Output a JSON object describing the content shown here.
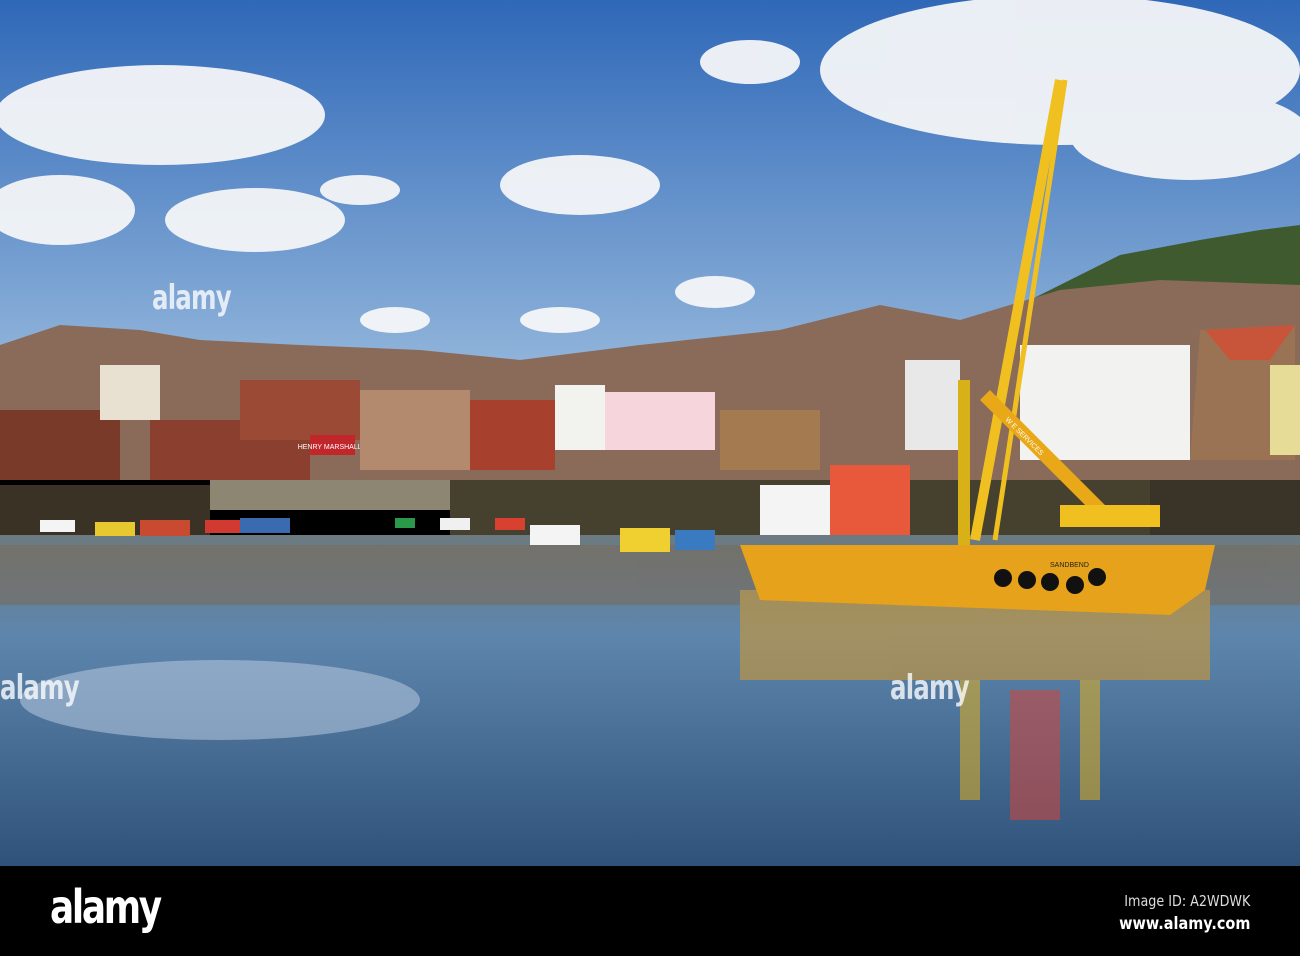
{
  "photo": {
    "signs": {
      "shop": "HENRY MARSHALLS",
      "boat_name": "SANDBEND",
      "crane_banner": "W E SERVICES"
    }
  },
  "watermarks": [
    "alamy",
    "alamy",
    "alamy"
  ],
  "footer": {
    "logo": "alamy",
    "image_id": "Image ID: A2WDWK",
    "website": "www.alamy.com"
  },
  "colors": {
    "sky": "#3f78c4",
    "water": "#3a5f86",
    "barge": "#e6a21a",
    "crane": "#f0c020"
  }
}
